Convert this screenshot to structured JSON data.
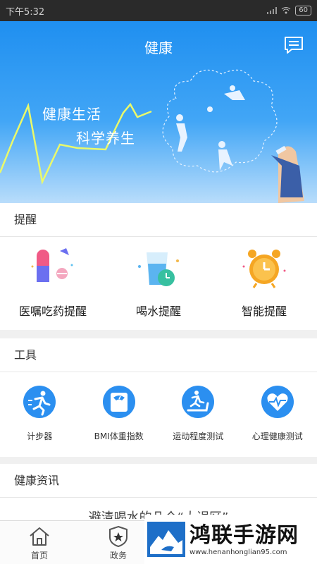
{
  "status_bar": {
    "time": "下午5:32",
    "battery": "60"
  },
  "header": {
    "title": "健康",
    "message_icon": "message-icon"
  },
  "banner": {
    "slogan_line1": "健康生活",
    "slogan_line2": "科学养生"
  },
  "reminders": {
    "title": "提醒",
    "items": [
      {
        "label": "医嘱吃药提醒",
        "icon": "pill-icon"
      },
      {
        "label": "喝水提醒",
        "icon": "water-glass-icon"
      },
      {
        "label": "智能提醒",
        "icon": "alarm-clock-icon"
      }
    ]
  },
  "tools": {
    "title": "工具",
    "items": [
      {
        "label": "计步器",
        "icon": "running-icon"
      },
      {
        "label": "BMI体重指数",
        "icon": "scale-icon"
      },
      {
        "label": "运动程度测试",
        "icon": "treadmill-icon"
      },
      {
        "label": "心理健康测试",
        "icon": "heart-icon"
      }
    ]
  },
  "news": {
    "title": "健康资讯",
    "first_item_partial": "避清喝水的几个“大误区”"
  },
  "tabbar": {
    "items": [
      {
        "label": "首页",
        "icon": "home-icon"
      },
      {
        "label": "政务",
        "icon": "badge-icon"
      }
    ]
  },
  "watermark": {
    "title": "鸿联手游网",
    "url": "www.henanhonglian95.com"
  },
  "colors": {
    "primary": "#2b91f0",
    "tool_icon": "#2b8ff0"
  }
}
